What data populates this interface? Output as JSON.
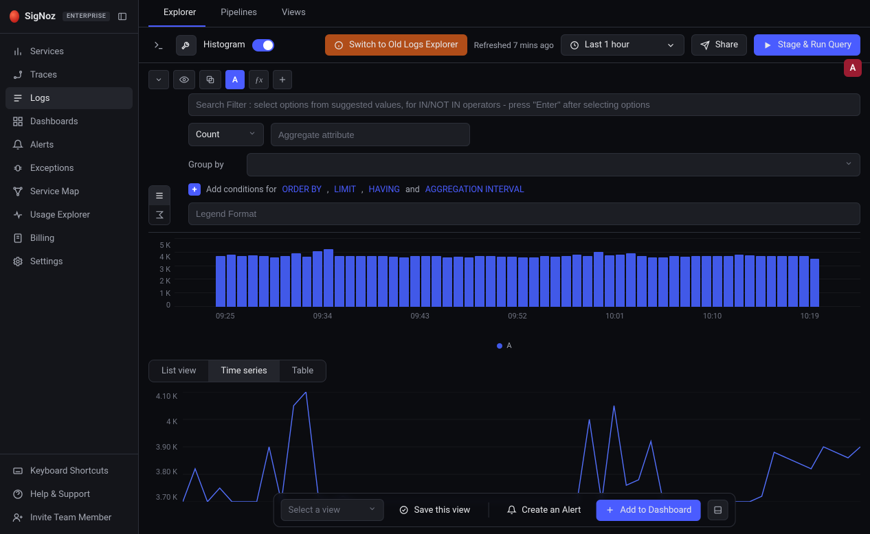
{
  "app": {
    "name": "SigNoz",
    "tier": "ENTERPRISE"
  },
  "sidebar": {
    "items": [
      {
        "icon": "bar-chart-icon",
        "label": "Services"
      },
      {
        "icon": "route-icon",
        "label": "Traces"
      },
      {
        "icon": "logs-icon",
        "label": "Logs",
        "active": true
      },
      {
        "icon": "grid-icon",
        "label": "Dashboards"
      },
      {
        "icon": "bell-icon",
        "label": "Alerts"
      },
      {
        "icon": "bug-icon",
        "label": "Exceptions"
      },
      {
        "icon": "map-icon",
        "label": "Service Map"
      },
      {
        "icon": "activity-icon",
        "label": "Usage Explorer"
      },
      {
        "icon": "receipt-icon",
        "label": "Billing"
      },
      {
        "icon": "gear-icon",
        "label": "Settings"
      }
    ],
    "footer": [
      {
        "icon": "keyboard-icon",
        "label": "Keyboard Shortcuts"
      },
      {
        "icon": "help-icon",
        "label": "Help & Support"
      },
      {
        "icon": "user-plus-icon",
        "label": "Invite Team Member"
      }
    ]
  },
  "tabs": [
    {
      "icon": "compass-icon",
      "label": "Explorer",
      "active": true
    },
    {
      "icon": "pipeline-icon",
      "label": "Pipelines"
    },
    {
      "icon": "layout-icon",
      "label": "Views"
    }
  ],
  "toolbar": {
    "histogram_label": "Histogram",
    "histogram_on": true,
    "switch_label": "Switch to Old Logs Explorer",
    "refreshed": "Refreshed 7 mins ago",
    "timerange": "Last 1 hour",
    "share_label": "Share",
    "run_label": "Stage & Run Query"
  },
  "query": {
    "badge": "A",
    "search_placeholder": "Search Filter : select options from suggested values, for IN/NOT IN operators - press \"Enter\" after selecting options",
    "aggregate": {
      "fn": "Count",
      "attr_placeholder": "Aggregate attribute"
    },
    "groupby_label": "Group by",
    "conditions": {
      "prefix": "Add conditions for",
      "orderby": "ORDER BY",
      "limit": "LIMIT",
      "having": "HAVING",
      "and": "and",
      "agg_interval": "AGGREGATION INTERVAL"
    },
    "legend_placeholder": "Legend Format"
  },
  "viewtabs": [
    {
      "label": "List view"
    },
    {
      "label": "Time series",
      "active": true
    },
    {
      "label": "Table"
    }
  ],
  "floatbar": {
    "select_view_placeholder": "Select a view",
    "save_view": "Save this view",
    "create_alert": "Create an Alert",
    "add_dashboard": "Add to Dashboard"
  },
  "chart_data": [
    {
      "name": "histogram",
      "type": "bar",
      "title": "",
      "xlabel": "",
      "ylabel": "",
      "ylim": [
        0,
        5000
      ],
      "y_ticks": [
        "5 K",
        "4 K",
        "3 K",
        "2 K",
        "1 K",
        "0"
      ],
      "x_ticks": [
        "09:25",
        "09:34",
        "09:43",
        "09:52",
        "10:01",
        "10:10",
        "10:19"
      ],
      "legend": "A",
      "categories_count": 56,
      "values": [
        3700,
        3820,
        3680,
        3750,
        3700,
        3600,
        3700,
        3900,
        3650,
        4050,
        4200,
        3720,
        3680,
        3720,
        3700,
        3700,
        3650,
        3600,
        3680,
        3700,
        3680,
        3620,
        3640,
        3600,
        3700,
        3680,
        3640,
        3660,
        3600,
        3620,
        3680,
        3660,
        3680,
        3800,
        3700,
        4020,
        3760,
        3780,
        3920,
        3680,
        3600,
        3620,
        3680,
        3640,
        3700,
        3680,
        3700,
        3720,
        3780,
        3760,
        3720,
        3700,
        3680,
        3700,
        3720,
        3500
      ]
    },
    {
      "name": "timeseries",
      "type": "line",
      "title": "",
      "xlabel": "",
      "ylabel": "",
      "ylim": [
        3700,
        4100
      ],
      "y_ticks": [
        "4.10 K",
        "4 K",
        "3.90 K",
        "3.80 K",
        "3.70 K"
      ],
      "series": [
        {
          "name": "A",
          "values": [
            3700,
            3820,
            3680,
            3750,
            3700,
            3600,
            3700,
            3900,
            3650,
            4050,
            4120,
            3720,
            3680,
            3720,
            3700,
            3700,
            3650,
            3580,
            3680,
            3700,
            3680,
            3620,
            3640,
            3600,
            3700,
            3680,
            3640,
            3660,
            3600,
            3620,
            3680,
            3660,
            3680,
            4000,
            3700,
            4050,
            3760,
            3780,
            3920,
            3680,
            3600,
            3620,
            3680,
            3640,
            3700,
            3680,
            3700,
            3720,
            3880,
            3860,
            3840,
            3820,
            3900,
            3880,
            3860,
            3900
          ]
        }
      ]
    }
  ]
}
